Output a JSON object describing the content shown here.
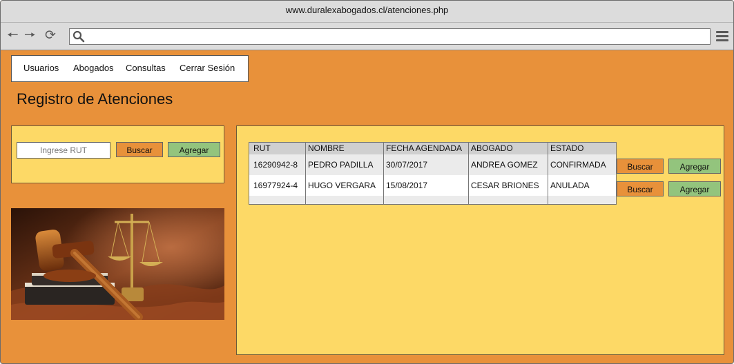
{
  "browser": {
    "url": "www.duralexabogados.cl/atenciones.php",
    "icons": [
      "back-arrow-icon",
      "forward-arrow-icon",
      "reload-icon",
      "search-icon",
      "hamburger-menu-icon"
    ]
  },
  "menu": {
    "items": [
      {
        "label": "Usuarios"
      },
      {
        "label": "Abogados"
      },
      {
        "label": "Consultas"
      },
      {
        "label": "Cerrar Sesión"
      }
    ]
  },
  "page": {
    "title": "Registro de Atenciones"
  },
  "search": {
    "placeholder": "Ingrese RUT",
    "buscar_label": "Buscar",
    "agregar_label": "Agregar"
  },
  "table": {
    "columns": [
      "RUT",
      "NOMBRE",
      "FECHA AGENDADA",
      "ABOGADO",
      "ESTADO"
    ],
    "rows": [
      [
        "16290942-8",
        "PEDRO PADILLA",
        "30/07/2017",
        "ANDREA GOMEZ",
        "CONFIRMADA"
      ],
      [
        "16977924-4",
        "HUGO VERGARA",
        "15/08/2017",
        "CESAR BRIONES",
        "ANULADA"
      ]
    ],
    "row_actions": [
      {
        "buscar": "Buscar",
        "agregar": "Agregar"
      },
      {
        "buscar": "Buscar",
        "agregar": "Agregar"
      }
    ]
  },
  "colors": {
    "page_bg": "#e8913a",
    "panel_bg": "#fdd966",
    "buscar_bg": "#e8913a",
    "agregar_bg": "#93c47d"
  }
}
